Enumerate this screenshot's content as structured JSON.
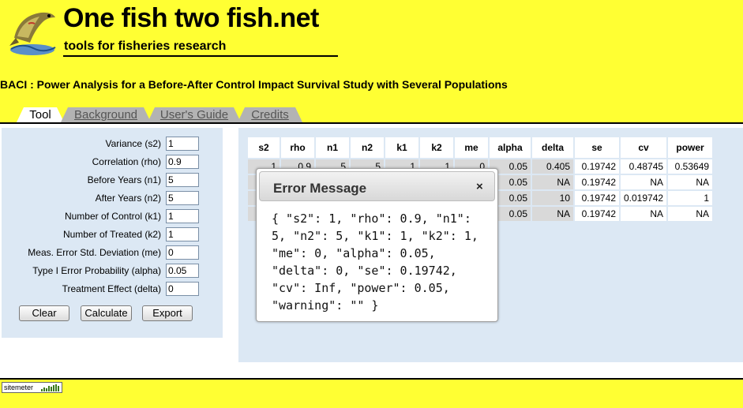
{
  "header": {
    "site_title": "One fish two fish.net",
    "site_subtitle": "tools for fisheries research",
    "logo_icon": "leaping-fish-icon"
  },
  "page_title": "BACI : Power Analysis for a Before-After Control Impact Survival Study with Several Populations",
  "tabs": [
    {
      "label": "Tool",
      "active": true
    },
    {
      "label": "Background",
      "active": false
    },
    {
      "label": "User's Guide",
      "active": false
    },
    {
      "label": "Credits",
      "active": false
    }
  ],
  "form": {
    "fields": [
      {
        "label": "Variance (s2)",
        "value": "1"
      },
      {
        "label": "Correlation (rho)",
        "value": "0.9"
      },
      {
        "label": "Before Years (n1)",
        "value": "5"
      },
      {
        "label": "After Years (n2)",
        "value": "5"
      },
      {
        "label": "Number of Control (k1)",
        "value": "1"
      },
      {
        "label": "Number of Treated (k2)",
        "value": "1"
      },
      {
        "label": "Meas. Error Std. Deviation (me)",
        "value": "0"
      },
      {
        "label": "Type I Error Probability (alpha)",
        "value": "0.05"
      },
      {
        "label": "Treatment Effect (delta)",
        "value": "0"
      }
    ],
    "buttons": {
      "clear": "Clear",
      "calculate": "Calculate",
      "export": "Export"
    }
  },
  "results": {
    "columns": [
      "s2",
      "rho",
      "n1",
      "n2",
      "k1",
      "k2",
      "me",
      "alpha",
      "delta",
      "se",
      "cv",
      "power"
    ],
    "rows": [
      [
        "1",
        "0.9",
        "5",
        "5",
        "1",
        "1",
        "0",
        "0.05",
        "0.405",
        "0.19742",
        "0.48745",
        "0.53649"
      ],
      [
        "",
        "",
        "",
        "",
        "",
        "",
        "",
        "0.05",
        "NA",
        "0.19742",
        "NA",
        "NA"
      ],
      [
        "",
        "",
        "",
        "",
        "",
        "",
        "",
        "0.05",
        "10",
        "0.19742",
        "0.019742",
        "1"
      ],
      [
        "",
        "",
        "",
        "",
        "",
        "",
        "",
        "0.05",
        "NA",
        "0.19742",
        "NA",
        "NA"
      ]
    ]
  },
  "dialog": {
    "title": "Error Message",
    "close_label": "×",
    "body": "{ \"s2\": 1, \"rho\": 0.9, \"n1\": 5, \"n2\": 5, \"k1\": 1, \"k2\": 1, \"me\": 0, \"alpha\": 0.05, \"delta\": 0, \"se\": 0.19742, \"cv\": Inf, \"power\": 0.05, \"warning\": \"\" }"
  },
  "footer": {
    "sitemeter_label": "sitemeter",
    "sitemeter_icon": "bar-chart-icon"
  }
}
